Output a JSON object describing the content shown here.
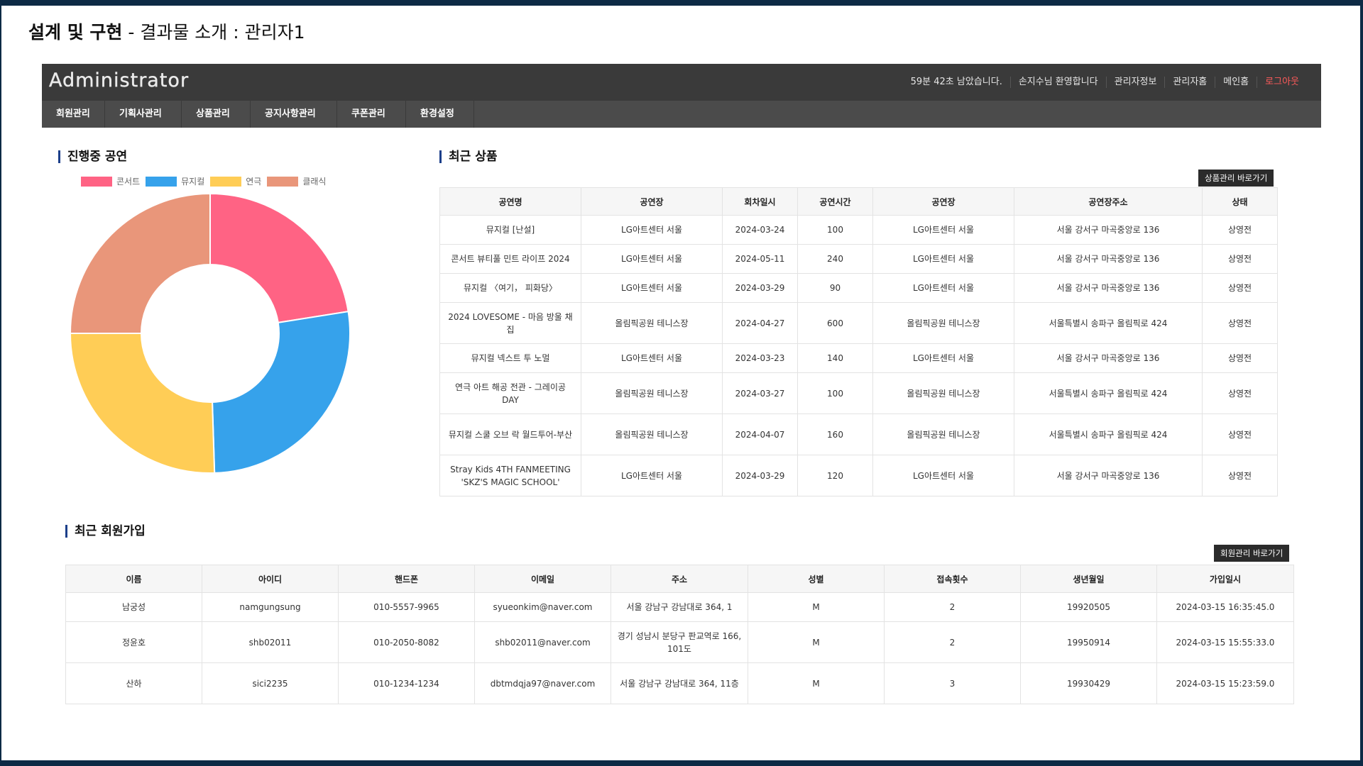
{
  "slide": {
    "title_bold": "설계 및 구현",
    "title_rest": " - 결과물 소개 : 관리자1"
  },
  "header": {
    "logo": "Administrator",
    "links": [
      "59분 42초 남았습니다.",
      "손지수님 환영합니다",
      "관리자정보",
      "관리자홈",
      "메인홈",
      "로그아웃"
    ]
  },
  "nav": [
    "회원관리",
    "기획사관리",
    "상품관리",
    "공지사항관리",
    "쿠폰관리",
    "환경설정"
  ],
  "ongoing": {
    "title": "진행중 공연",
    "chart_data": {
      "type": "pie",
      "style": "doughnut",
      "labels": [
        "콘서트",
        "뮤지컬",
        "연극",
        "클래식"
      ],
      "values": [
        22.5,
        27,
        25.5,
        25
      ],
      "colors": [
        "#ff6384",
        "#36a2eb",
        "#ffcd56",
        "#e9967a"
      ],
      "legend": "top"
    }
  },
  "products": {
    "title": "최근 상품",
    "button": "상품관리 바로가기",
    "columns": [
      "공연명",
      "공연장",
      "회차일시",
      "공연시간",
      "공연장",
      "공연장주소",
      "상태"
    ],
    "rows": [
      [
        "뮤지컬 [난설]",
        "LG아트센터 서울",
        "2024-03-24",
        "100",
        "LG아트센터 서울",
        "서울 강서구 마곡중앙로 136",
        "상영전"
      ],
      [
        "콘서트 뷰티풀 민트 라이프 2024",
        "LG아트센터 서울",
        "2024-05-11",
        "240",
        "LG아트센터 서울",
        "서울 강서구 마곡중앙로 136",
        "상영전"
      ],
      [
        "뮤지컬 〈여기， 피화당〉",
        "LG아트센터 서울",
        "2024-03-29",
        "90",
        "LG아트센터 서울",
        "서울 강서구 마곡중앙로 136",
        "상영전"
      ],
      [
        "2024 LOVESOME - 마음 방울 채집",
        "올림픽공원 테니스장",
        "2024-04-27",
        "600",
        "올림픽공원 테니스장",
        "서울특별시 송파구 올림픽로 424",
        "상영전"
      ],
      [
        "뮤지컬 넥스트 투 노멀",
        "LG아트센터 서울",
        "2024-03-23",
        "140",
        "LG아트센터 서울",
        "서울 강서구 마곡중앙로 136",
        "상영전"
      ],
      [
        "연극 아트 해공 전관 - 그레이공 DAY",
        "올림픽공원 테니스장",
        "2024-03-27",
        "100",
        "올림픽공원 테니스장",
        "서울특별시 송파구 올림픽로 424",
        "상영전"
      ],
      [
        "뮤지컬 스쿨 오브 락 월드투어-부산",
        "올림픽공원 테니스장",
        "2024-04-07",
        "160",
        "올림픽공원 테니스장",
        "서울특별시 송파구 올림픽로 424",
        "상영전"
      ],
      [
        "Stray Kids 4TH FANMEETING 'SKZ'S MAGIC SCHOOL'",
        "LG아트센터 서울",
        "2024-03-29",
        "120",
        "LG아트센터 서울",
        "서울 강서구 마곡중앙로 136",
        "상영전"
      ]
    ]
  },
  "members": {
    "title": "최근 회원가입",
    "button": "회원관리 바로가기",
    "columns": [
      "이름",
      "아이디",
      "핸드폰",
      "이메일",
      "주소",
      "성별",
      "접속횟수",
      "생년월일",
      "가입일시"
    ],
    "rows": [
      [
        "남궁성",
        "namgungsung",
        "010-5557-9965",
        "syueonkim@naver.com",
        "서울 강남구 강남대로 364, 1",
        "M",
        "2",
        "19920505",
        "2024-03-15 16:35:45.0"
      ],
      [
        "정윤호",
        "shb02011",
        "010-2050-8082",
        "shb02011@naver.com",
        "경기 성남시 분당구 판교역로 166, 101도",
        "M",
        "2",
        "19950914",
        "2024-03-15 15:55:33.0"
      ],
      [
        "산하",
        "sici2235",
        "010-1234-1234",
        "dbtmdqja97@naver.com",
        "서울 강남구 강남대로 364, 11층",
        "M",
        "3",
        "19930429",
        "2024-03-15 15:23:59.0"
      ]
    ]
  }
}
